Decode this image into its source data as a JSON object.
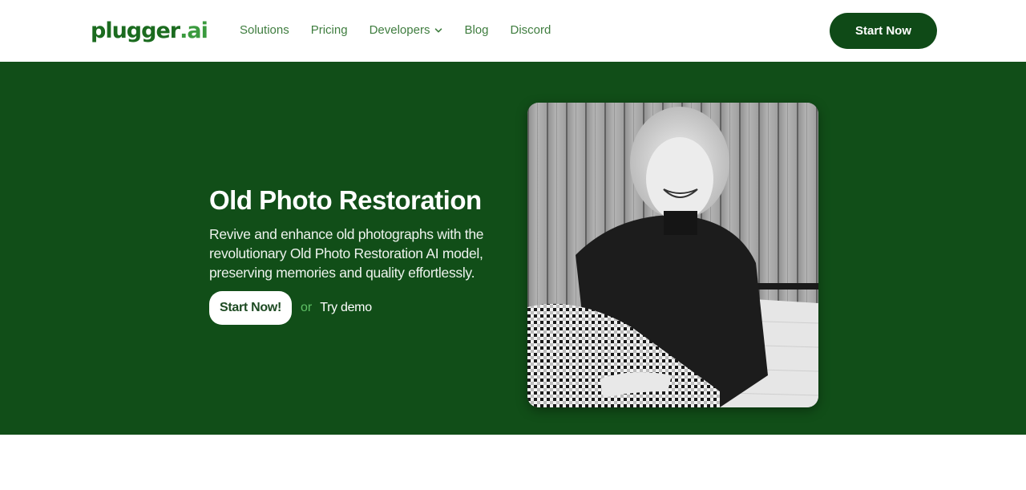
{
  "header": {
    "logo": {
      "main": "plugger",
      "suffix": ".ai"
    },
    "nav": [
      {
        "label": "Solutions"
      },
      {
        "label": "Pricing"
      },
      {
        "label": "Developers",
        "has_dropdown": true
      },
      {
        "label": "Blog"
      },
      {
        "label": "Discord"
      }
    ],
    "cta_label": "Start Now"
  },
  "hero": {
    "title": "Old Photo Restoration",
    "description": "Revive and enhance old photographs with the revolutionary Old Photo Restoration AI model, preserving memories and quality effortlessly.",
    "primary_cta": "Start Now!",
    "or_text": "or",
    "secondary_cta": "Try demo",
    "image_alt": "Black and white photo of a smiling woman in a turtleneck and gingham skirt"
  },
  "colors": {
    "brand_green": "#114e18",
    "button_dark": "#0f4a17",
    "nav_text": "#3f7d3f",
    "or_text": "#5ec065"
  }
}
